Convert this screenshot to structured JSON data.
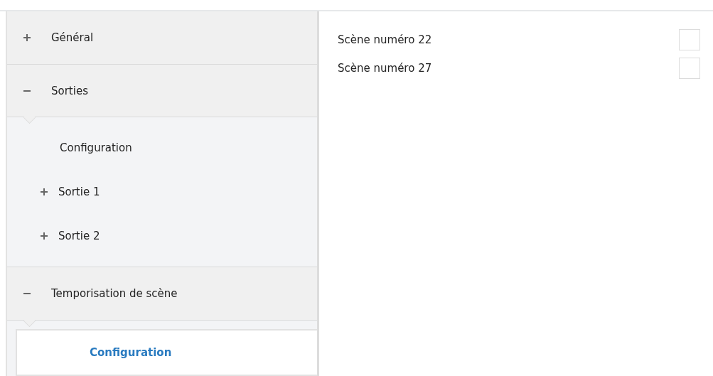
{
  "sidebar": {
    "sections": [
      {
        "label": "Général",
        "expanded": false
      },
      {
        "label": "Sorties",
        "expanded": true,
        "children": [
          {
            "label": "Configuration",
            "expandable": false,
            "selected": false
          },
          {
            "label": "Sortie 1",
            "expandable": true,
            "selected": false
          },
          {
            "label": "Sortie 2",
            "expandable": true,
            "selected": false
          }
        ]
      },
      {
        "label": "Temporisation de scène",
        "expanded": true,
        "children": [
          {
            "label": "Configuration",
            "expandable": false,
            "selected": true
          }
        ]
      }
    ]
  },
  "settings": [
    {
      "label": "Scène numéro 22",
      "checked": false
    },
    {
      "label": "Scène numéro 27",
      "checked": false
    }
  ]
}
